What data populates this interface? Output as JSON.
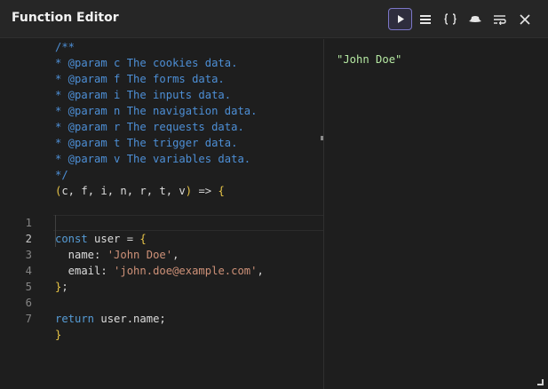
{
  "window": {
    "title": "Function Editor"
  },
  "toolbar": {
    "buttons": [
      {
        "icon": "play-icon",
        "active": true
      },
      {
        "icon": "list-icon"
      },
      {
        "icon": "braces-icon"
      },
      {
        "icon": "hat-icon"
      },
      {
        "icon": "wrap-icon"
      },
      {
        "icon": "close-icon"
      }
    ]
  },
  "editor": {
    "doc_comment": [
      "/**",
      "* @param c The cookies data.",
      "* @param f The forms data.",
      "* @param i The inputs data.",
      "* @param n The navigation data.",
      "* @param r The requests data.",
      "* @param t The trigger data.",
      "* @param v The variables data.",
      "*/"
    ],
    "signature": {
      "open_paren": "(",
      "params": "c, f, i, n, r, t, v",
      "close_paren": ")",
      "arrow": " => ",
      "open_brace": "{"
    },
    "lines": [
      {
        "number": "1",
        "kw": "const",
        "id": " user ",
        "op": "= ",
        "br": "{"
      },
      {
        "number": "2",
        "current": true,
        "key": "  name: ",
        "str": "'John Doe'",
        "tail": ","
      },
      {
        "number": "3",
        "key": "  email: ",
        "str": "'john.doe@example.com'",
        "tail": ","
      },
      {
        "number": "4",
        "br": "}",
        "tail": ";"
      },
      {
        "number": "5"
      },
      {
        "number": "6",
        "kw": "return",
        "id": " user.name;"
      },
      {
        "number": "7"
      }
    ],
    "closing_brace": "}"
  },
  "output": {
    "value": "\"John Doe\""
  },
  "colors": {
    "background": "#1e1e1e",
    "comment": "#4d8fd6",
    "keyword": "#569cd6",
    "bracket": "#e8c547",
    "string": "#ce9178",
    "result": "#b5e8a2",
    "active_button_border": "#7c77c8"
  }
}
